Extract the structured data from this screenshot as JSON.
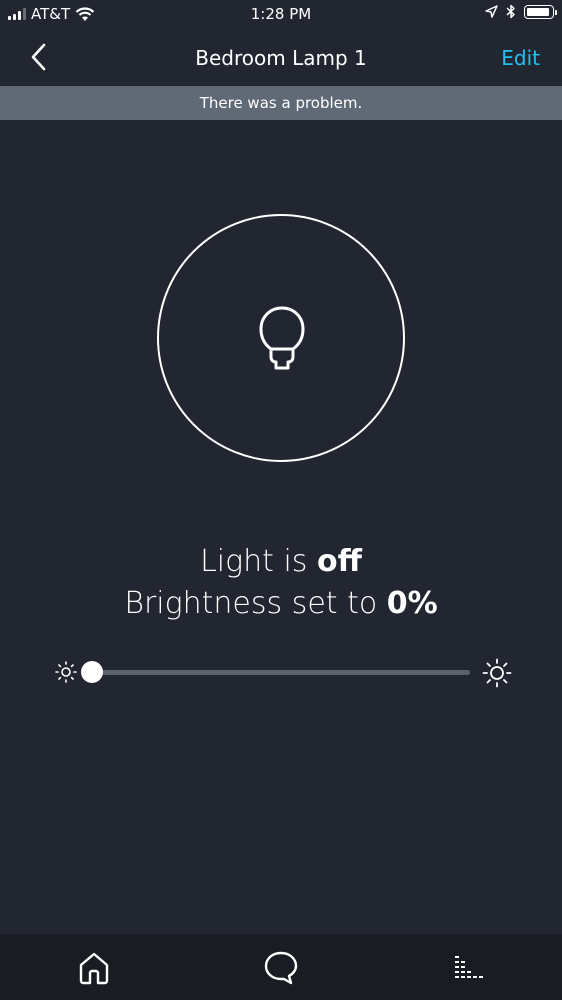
{
  "status_bar": {
    "carrier": "AT&T",
    "time": "1:28 PM"
  },
  "nav": {
    "title": "Bedroom Lamp 1",
    "edit_label": "Edit"
  },
  "banner": {
    "message": "There was a problem."
  },
  "device": {
    "light_prefix": "Light is ",
    "light_state": "off",
    "brightness_prefix": "Brightness set to ",
    "brightness_value": "0%",
    "brightness_level": 0
  },
  "icons": {
    "back": "chevron-left-icon",
    "bulb": "light-bulb-icon",
    "dim": "sun-dim-icon",
    "bright": "sun-bright-icon",
    "home": "home-icon",
    "communicate": "chat-bubble-icon",
    "activity": "equalizer-icon"
  },
  "colors": {
    "background": "#222631",
    "accent": "#1fc1f0",
    "banner": "#5f6a76",
    "tab_bar": "#191c23"
  }
}
